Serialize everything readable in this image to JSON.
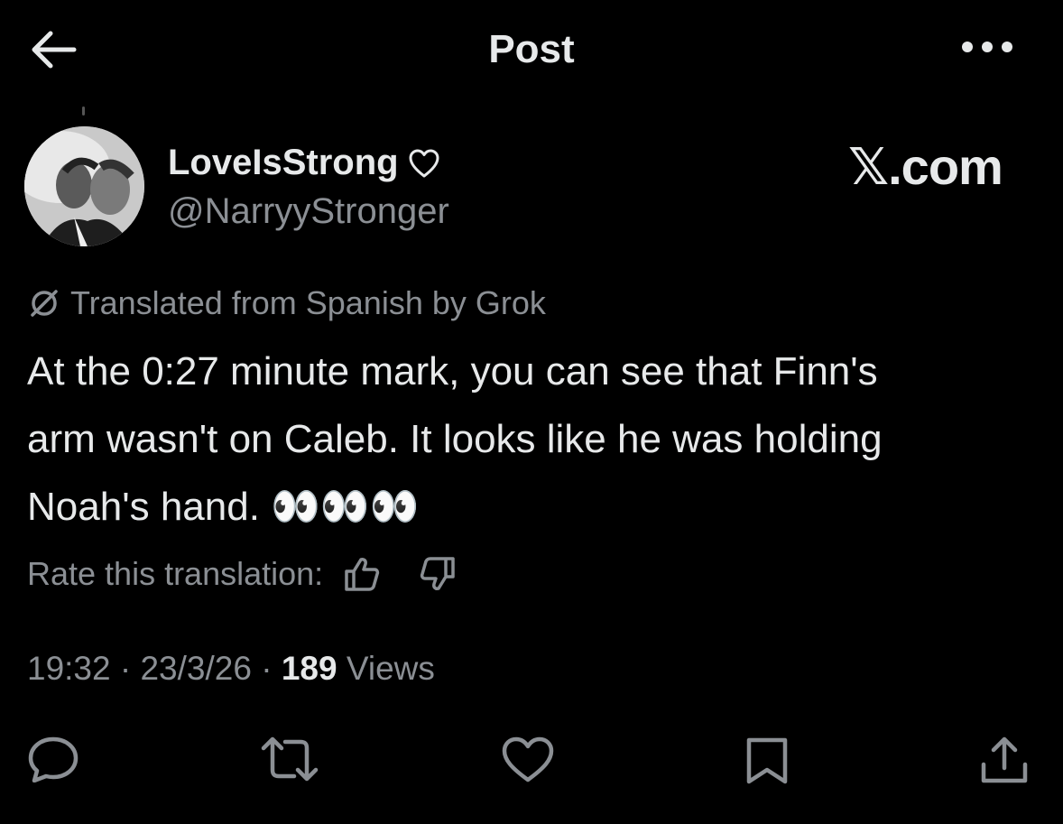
{
  "header": {
    "title": "Post",
    "back_icon": "arrow-left-icon",
    "more_icon": "more-horizontal-icon"
  },
  "post": {
    "display_name": "LoveIsStrong",
    "display_name_emoji": "heart-outline-icon",
    "handle": "@NarryyStronger",
    "watermark": "𝕏.com",
    "translation_note": "Translated from Spanish by Grok",
    "text_line1": "At the 0:27 minute mark, you can see that Finn's",
    "text_line2": "arm wasn't on Caleb. It looks like he was holding",
    "text_line3": "Noah's hand. 👀👀👀",
    "rate_label": "Rate this translation:",
    "time": "19:32",
    "date": "23/3/26",
    "views_count": "189",
    "views_label": "Views",
    "separator": "·"
  },
  "actions": [
    {
      "name": "reply-icon"
    },
    {
      "name": "repost-icon"
    },
    {
      "name": "like-icon"
    },
    {
      "name": "bookmark-icon"
    },
    {
      "name": "share-icon"
    }
  ],
  "colors": {
    "background": "#000000",
    "text": "#e7e9ea",
    "secondary_text": "#8b8f94"
  }
}
